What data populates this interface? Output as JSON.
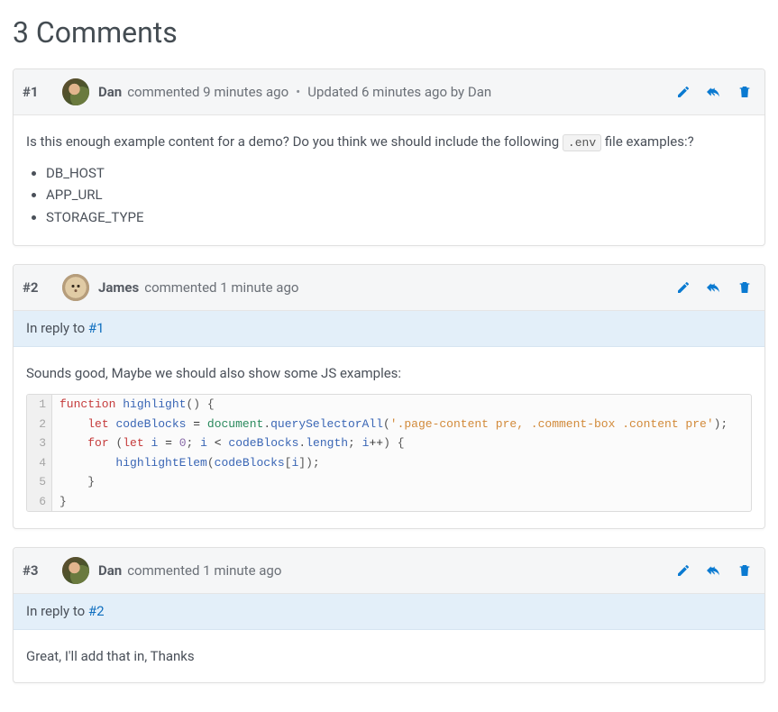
{
  "pageTitle": "3 Comments",
  "inlineCode": ".env",
  "replyPrefix": "In reply to",
  "comments": [
    {
      "number": "#1",
      "author": "Dan",
      "avatarClass": "dan",
      "metaPrefix": "commented",
      "timeAgo": "9 minutes ago",
      "updatedText": "Updated 6 minutes ago by Dan",
      "replyTo": null,
      "body": {
        "paragraphBefore": "Is this enough example content for a demo? Do you think we should include the following ",
        "paragraphAfter": " file examples:?",
        "listItems": [
          "DB_HOST",
          "APP_URL",
          "STORAGE_TYPE"
        ]
      }
    },
    {
      "number": "#2",
      "author": "James",
      "avatarClass": "james",
      "metaPrefix": "commented",
      "timeAgo": "1 minute ago",
      "updatedText": null,
      "replyTo": "#1",
      "body": {
        "paragraph": "Sounds good, Maybe we should also show some JS examples:",
        "codeLines": [
          [
            [
              "kw",
              "function"
            ],
            [
              "plain",
              " "
            ],
            [
              "fn",
              "highlight"
            ],
            [
              "punc",
              "()"
            ],
            [
              "plain",
              " "
            ],
            [
              "punc",
              "{"
            ]
          ],
          [
            [
              "plain",
              "    "
            ],
            [
              "kw",
              "let"
            ],
            [
              "plain",
              " "
            ],
            [
              "fn",
              "codeBlocks"
            ],
            [
              "plain",
              " "
            ],
            [
              "op",
              "="
            ],
            [
              "plain",
              " "
            ],
            [
              "glob",
              "document"
            ],
            [
              "punc",
              "."
            ],
            [
              "fn",
              "querySelectorAll"
            ],
            [
              "punc",
              "("
            ],
            [
              "str",
              "'.page-content pre, .comment-box .content pre'"
            ],
            [
              "punc",
              ");"
            ]
          ],
          [
            [
              "plain",
              "    "
            ],
            [
              "kw",
              "for"
            ],
            [
              "plain",
              " "
            ],
            [
              "punc",
              "("
            ],
            [
              "kw",
              "let"
            ],
            [
              "plain",
              " "
            ],
            [
              "fn",
              "i"
            ],
            [
              "plain",
              " "
            ],
            [
              "op",
              "="
            ],
            [
              "plain",
              " "
            ],
            [
              "num",
              "0"
            ],
            [
              "punc",
              ";"
            ],
            [
              "plain",
              " "
            ],
            [
              "fn",
              "i"
            ],
            [
              "plain",
              " "
            ],
            [
              "op",
              "<"
            ],
            [
              "plain",
              " "
            ],
            [
              "fn",
              "codeBlocks"
            ],
            [
              "punc",
              "."
            ],
            [
              "fn",
              "length"
            ],
            [
              "punc",
              ";"
            ],
            [
              "plain",
              " "
            ],
            [
              "fn",
              "i"
            ],
            [
              "op",
              "++"
            ],
            [
              "punc",
              ")"
            ],
            [
              "plain",
              " "
            ],
            [
              "punc",
              "{"
            ]
          ],
          [
            [
              "plain",
              "        "
            ],
            [
              "fn",
              "highlightElem"
            ],
            [
              "punc",
              "("
            ],
            [
              "fn",
              "codeBlocks"
            ],
            [
              "punc",
              "["
            ],
            [
              "fn",
              "i"
            ],
            [
              "punc",
              "]);"
            ]
          ],
          [
            [
              "plain",
              "    "
            ],
            [
              "punc",
              "}"
            ]
          ],
          [
            [
              "punc",
              "}"
            ]
          ]
        ]
      }
    },
    {
      "number": "#3",
      "author": "Dan",
      "avatarClass": "dan",
      "metaPrefix": "commented",
      "timeAgo": "1 minute ago",
      "updatedText": null,
      "replyTo": "#2",
      "body": {
        "paragraph": "Great, I'll add that in, Thanks"
      }
    }
  ]
}
